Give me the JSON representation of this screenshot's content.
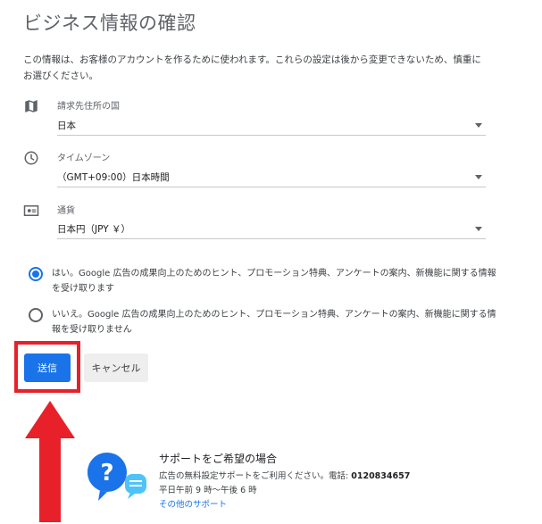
{
  "page": {
    "title": "ビジネス情報の確認",
    "intro": "この情報は、お客様のアカウントを作るために使われます。これらの設定は後から変更できないため、慎重にお選びください。"
  },
  "fields": {
    "country": {
      "label": "請求先住所の国",
      "value": "日本",
      "icon": "map-icon"
    },
    "timezone": {
      "label": "タイムゾーン",
      "value": "（GMT+09:00）日本時間",
      "icon": "clock-icon"
    },
    "currency": {
      "label": "通貨",
      "value": "日本円（JPY ￥）",
      "icon": "currency-icon"
    }
  },
  "options": {
    "yes": {
      "text": "はい。Google 広告の成果向上のためのヒント、プロモーション特典、アンケートの案内、新機能に関する情報を受け取ります",
      "selected": true
    },
    "no": {
      "text": "いいえ。Google 広告の成果向上のためのヒント、プロモーション特典、アンケートの案内、新機能に関する情報を受け取りません",
      "selected": false
    }
  },
  "actions": {
    "submit_label": "送信",
    "cancel_label": "キャンセル"
  },
  "support": {
    "title": "サポートをご希望の場合",
    "line1_prefix": "広告の無料設定サポートをご利用ください。電話: ",
    "phone": "0120834657",
    "hours": "平日午前 9 時～午後 6 時",
    "link_label": "その他のサポート"
  },
  "colors": {
    "accent": "#1a73e8",
    "highlight": "#e8202a",
    "support_icon_blue": "#1a73e8",
    "support_chat_blue": "#4fc3f7"
  }
}
